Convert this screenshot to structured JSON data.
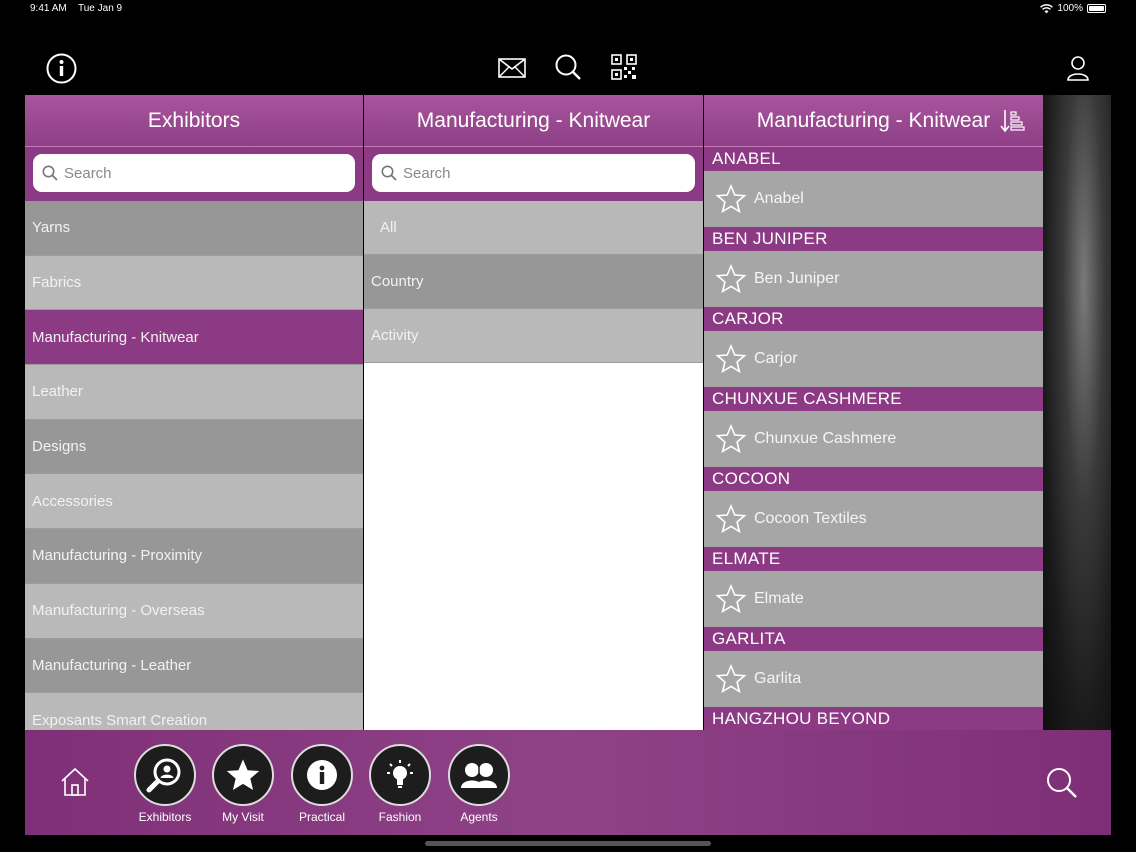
{
  "status_bar": {
    "time": "9:41 AM",
    "date": "Tue Jan 9",
    "battery": "100%"
  },
  "toolbar": {
    "info_icon": "info-icon",
    "mail_icon": "mail-icon",
    "search_icon": "search-icon",
    "qr_icon": "qr-code-icon",
    "profile_icon": "user-icon"
  },
  "panel_categories": {
    "title": "Exhibitors",
    "search_placeholder": "Search",
    "items": [
      "Yarns",
      "Fabrics",
      "Manufacturing - Knitwear",
      "Leather",
      "Designs",
      "Accessories",
      "Manufacturing - Proximity",
      "Manufacturing - Overseas",
      "Manufacturing - Leather",
      "Exposants Smart Creation"
    ],
    "selected_index": 2
  },
  "panel_filters": {
    "title": "Manufacturing - Knitwear",
    "search_placeholder": "Search",
    "items": [
      "All",
      "Country",
      "Activity"
    ]
  },
  "panel_exhibitors": {
    "title": "Manufacturing - Knitwear",
    "sort_icon": "sort-icon",
    "groups": [
      {
        "header": "ANABEL",
        "name": "Anabel"
      },
      {
        "header": "BEN JUNIPER",
        "name": "Ben Juniper"
      },
      {
        "header": "CARJOR",
        "name": "Carjor"
      },
      {
        "header": "CHUNXUE CASHMERE",
        "name": "Chunxue Cashmere"
      },
      {
        "header": "COCOON",
        "name": "Cocoon Textiles"
      },
      {
        "header": "ELMATE",
        "name": "Elmate"
      },
      {
        "header": "GARLITA",
        "name": "Garlita"
      },
      {
        "header": "HANGZHOU BEYOND",
        "name": ""
      }
    ]
  },
  "bottom_nav": {
    "home_icon": "home-icon",
    "items": [
      {
        "label": "Exhibitors",
        "icon": "exhibitor-search-icon"
      },
      {
        "label": "My Visit",
        "icon": "star-icon"
      },
      {
        "label": "Practical",
        "icon": "info-icon"
      },
      {
        "label": "Fashion",
        "icon": "lightbulb-icon"
      },
      {
        "label": "Agents",
        "icon": "agents-icon"
      }
    ],
    "search_icon": "search-icon"
  },
  "colors": {
    "accent": "#8c3a84",
    "header": "#a04f96",
    "row_dark": "#979797",
    "row_light": "#b9b9b9"
  }
}
